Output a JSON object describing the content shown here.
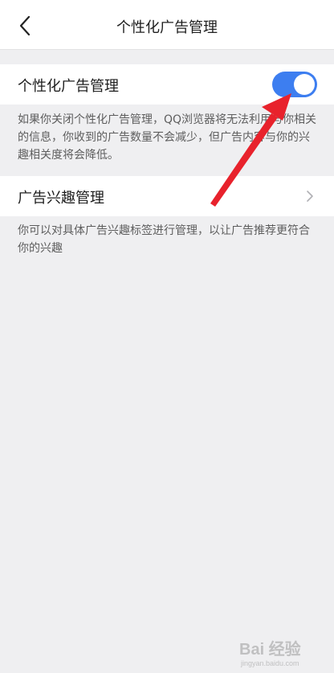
{
  "header": {
    "title": "个性化广告管理"
  },
  "settings": {
    "personalized_ads": {
      "label": "个性化广告管理",
      "enabled": true,
      "description": "如果你关闭个性化广告管理，QQ浏览器将无法利用与你相关的信息，你收到的广告数量不会减少，但广告内容与你的兴趣相关度将会降低。"
    },
    "interest_management": {
      "label": "广告兴趣管理",
      "description": "你可以对具体广告兴趣标签进行管理，以让广告推荐更符合你的兴趣"
    }
  },
  "colors": {
    "accent": "#3d7ef0",
    "annotation": "#e8222c",
    "background": "#efeff1"
  },
  "icons": {
    "back": "chevron-left-icon",
    "row_arrow": "chevron-right-icon",
    "watermark": "baidu-jingyan-logo"
  },
  "watermark": {
    "text": "Bai 经验",
    "subtext": "jingyan.baidu.com"
  }
}
